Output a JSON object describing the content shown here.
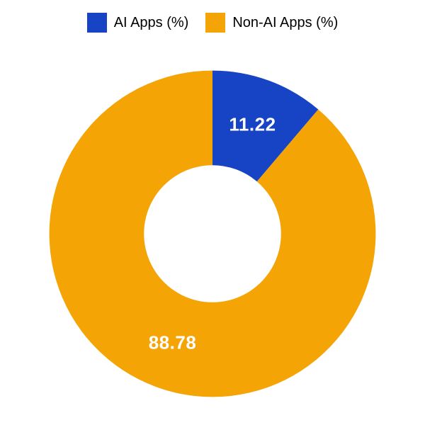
{
  "chart_data": {
    "type": "pie",
    "title": "",
    "series": [
      {
        "name": "AI Apps (%)",
        "value": 11.22,
        "color": "#1744c4"
      },
      {
        "name": "Non-AI Apps (%)",
        "value": 88.78,
        "color": "#f5a406"
      }
    ],
    "inner_radius_pct": 42,
    "outer_radius_pct": 100
  },
  "legend": {
    "items": [
      {
        "label": "AI Apps (%)",
        "color": "#1744c4"
      },
      {
        "label": "Non-AI Apps (%)",
        "color": "#f5a406"
      }
    ]
  },
  "labels": {
    "slice0": "11.22",
    "slice1": "88.78"
  }
}
